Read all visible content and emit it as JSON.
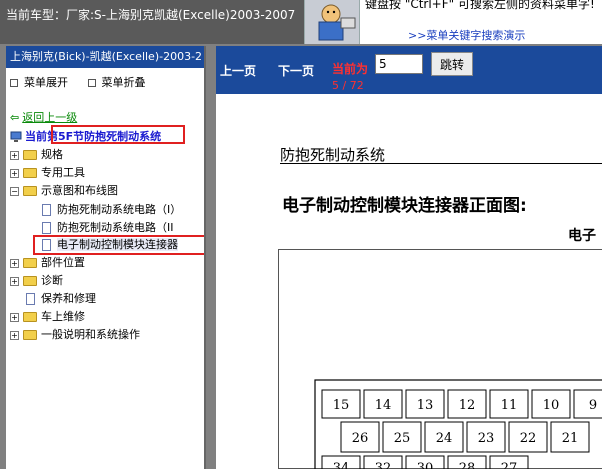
{
  "header": {
    "vehicle": "当前车型：厂家:S-上海别克凯越(Excelle)2003-2007",
    "tip": "键盘按 \"Ctrl+F\" 可搜索左侧的资料菜单字!",
    "tip_link": ">>菜单关键字搜索演示"
  },
  "sidebar": {
    "title": "上海别克(Bick)-凯越(Excelle)-2003-2",
    "expand": "菜单展开",
    "collapse": "菜单折叠",
    "back": "返回上一级",
    "current_label": "当前",
    "current_section": "第5F节防抱死制动系统",
    "tree": [
      {
        "label": "规格",
        "type": "folder",
        "toggle": "+"
      },
      {
        "label": "专用工具",
        "type": "folder",
        "toggle": "+"
      },
      {
        "label": "示意图和布线图",
        "type": "folder",
        "toggle": "−"
      },
      {
        "label": "防抱死制动系统电路（I）",
        "type": "doc"
      },
      {
        "label": "防抱死制动系统电路（II",
        "type": "doc"
      },
      {
        "label": "电子制动控制模块连接器",
        "type": "doc"
      },
      {
        "label": "部件位置",
        "type": "folder",
        "toggle": "+"
      },
      {
        "label": "诊断",
        "type": "folder",
        "toggle": "+"
      },
      {
        "label": "保养和修理",
        "type": "doc"
      },
      {
        "label": "车上维修",
        "type": "folder",
        "toggle": "+"
      },
      {
        "label": "一般说明和系统操作",
        "type": "folder",
        "toggle": "+"
      }
    ]
  },
  "nav": {
    "prev": "上一页",
    "next": "下一页",
    "current_label": "当前为",
    "page_value": "5",
    "jump": "跳转",
    "page_count": "5 / 72"
  },
  "document": {
    "system_title": "防抱死制动系统",
    "connector_title": "电子制动控制模块连接器正面图:",
    "connector_sub": "电子",
    "pins_row1": [
      "15",
      "14",
      "13",
      "12",
      "11",
      "10",
      "9"
    ],
    "pins_row2": [
      "26",
      "25",
      "24",
      "23",
      "22",
      "21"
    ],
    "pins_row3": [
      "34",
      "32",
      "30",
      "28",
      "27"
    ]
  },
  "colors": {
    "accent_blue": "#1b4a9b",
    "highlight_red": "#e02020",
    "page_red": "#ff3030"
  }
}
